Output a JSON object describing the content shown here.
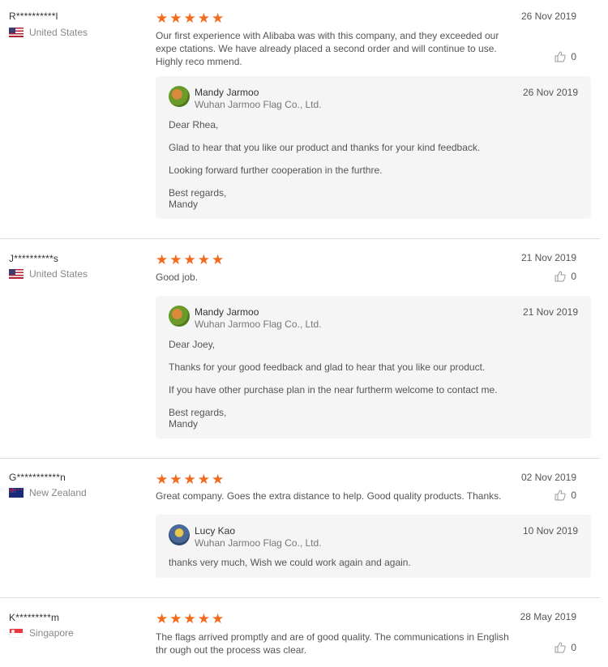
{
  "reviews": [
    {
      "buyer": "R**********l",
      "country": "United States",
      "flag": "us-flag",
      "stars": 5,
      "date": "26 Nov 2019",
      "text": "Our first experience with Alibaba was with this company, and they exceeded our expe ctations. We have already placed a second order and will continue to use. Highly reco mmend.",
      "likes": "0",
      "reply": {
        "name": "Mandy Jarmoo",
        "company": "Wuhan Jarmoo Flag Co., Ltd.",
        "date": "26 Nov 2019",
        "lines": [
          "Dear Rhea,",
          "Glad to hear that you like our product and thanks for your kind feedback.",
          "Looking forward further cooperation in the furthre.",
          "Best regards,",
          "Mandy"
        ]
      }
    },
    {
      "buyer": "J**********s",
      "country": "United States",
      "flag": "us-flag",
      "stars": 5,
      "date": "21 Nov 2019",
      "text": "Good job.",
      "likes": "0",
      "reply": {
        "name": "Mandy Jarmoo",
        "company": "Wuhan Jarmoo Flag Co., Ltd.",
        "date": "21 Nov 2019",
        "lines": [
          "Dear Joey,",
          "Thanks for your good feedback and glad to hear that you like our product.",
          "If you have other purchase plan in the near furtherm welcome to contact me.",
          "Best regards,",
          "Mandy"
        ]
      }
    },
    {
      "buyer": "G***********n",
      "country": "New Zealand",
      "flag": "nz-flag",
      "stars": 5,
      "date": "02 Nov 2019",
      "text": "Great company. Goes the extra distance to help. Good quality products. Thanks.",
      "likes": "0",
      "reply": {
        "name": "Lucy Kao",
        "company": "Wuhan Jarmoo Flag Co., Ltd.",
        "date": "10 Nov 2019",
        "lines": [
          "thanks very much, Wish we could work again and again."
        ]
      }
    },
    {
      "buyer": "K*********m",
      "country": "Singapore",
      "flag": "sg-flag",
      "stars": 5,
      "date": "28 May 2019",
      "text": "The flags arrived promptly and are of good quality. The communications in English thr ough out the process was clear.",
      "likes": "0"
    }
  ],
  "icons": {
    "star": "star-icon",
    "like": "thumbs-up-icon"
  },
  "colors": {
    "star": "#f26a1b",
    "reply_bg": "#f5f5f5"
  }
}
